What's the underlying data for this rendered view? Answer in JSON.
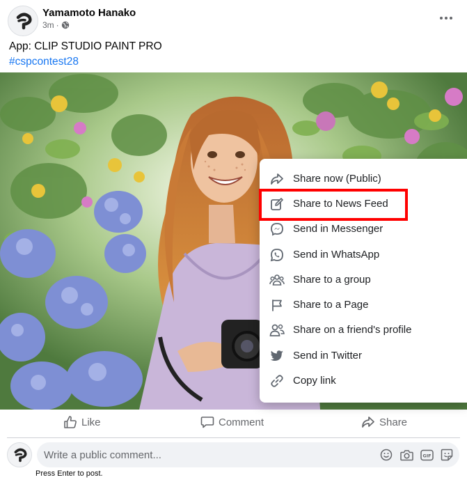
{
  "post": {
    "author": "Yamamoto Hanako",
    "time": "3m",
    "separator": "·",
    "privacy_icon": "globe-icon",
    "more_icon": "more-options-icon",
    "text": "App: CLIP STUDIO PAINT PRO",
    "hashtag": "#cspcontest28",
    "image": "illustration-girl-with-camera-among-hydrangeas"
  },
  "share_menu": {
    "items": [
      {
        "label": "Share now (Public)",
        "icon": "share-arrow-icon"
      },
      {
        "label": "Share to News Feed",
        "icon": "edit-icon"
      },
      {
        "label": "Send in Messenger",
        "icon": "messenger-icon"
      },
      {
        "label": "Send in WhatsApp",
        "icon": "whatsapp-icon"
      },
      {
        "label": "Share to a group",
        "icon": "group-icon"
      },
      {
        "label": "Share to a Page",
        "icon": "flag-icon"
      },
      {
        "label": "Share on a friend's profile",
        "icon": "friend-profile-icon"
      },
      {
        "label": "Send in Twitter",
        "icon": "twitter-icon"
      },
      {
        "label": "Copy link",
        "icon": "link-icon"
      }
    ],
    "highlighted": "Share to News Feed",
    "highlight_color": "#ff0000"
  },
  "actions": {
    "like": "Like",
    "comment": "Comment",
    "share": "Share"
  },
  "comment": {
    "placeholder": "Write a public comment...",
    "hint": "Press Enter to post.",
    "icons": [
      "emoji-icon",
      "camera-icon",
      "gif-icon",
      "sticker-icon"
    ]
  },
  "colors": {
    "link": "#1877f2",
    "secondary_text": "#65676b",
    "highlight": "#ff0000"
  }
}
